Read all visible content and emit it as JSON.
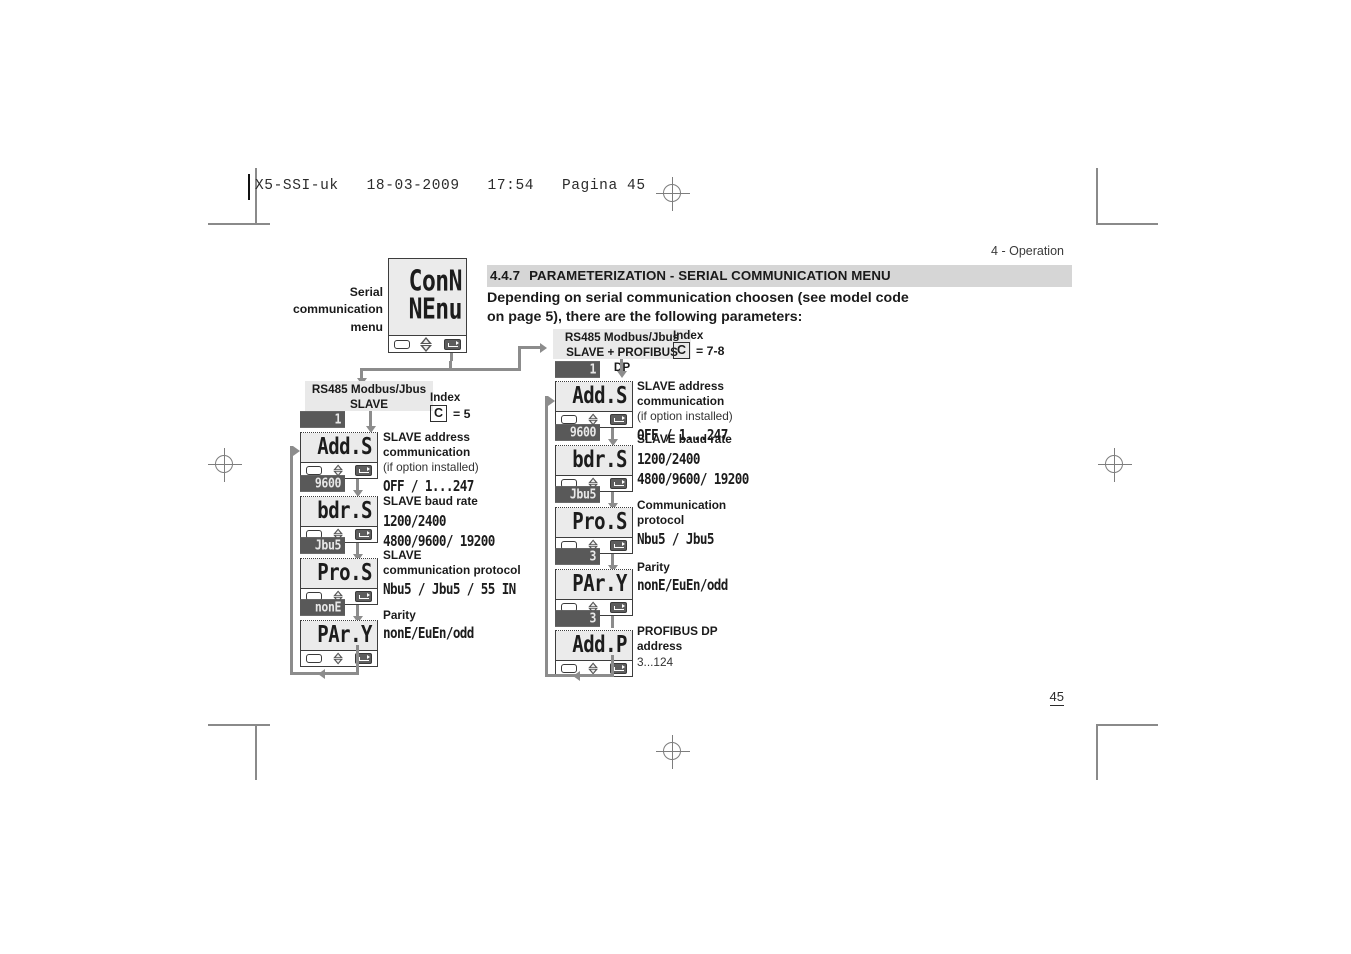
{
  "file_header": "X5-SSI-uk   18-03-2009   17:54   Pagina 45",
  "running_head": "4 - Operation",
  "page_number": "45",
  "section": {
    "number": "4.4.7",
    "title": "PARAMETERIZATION - SERIAL COMMUNICATION MENU",
    "intro_line1": "Depending on serial communication choosen (see model code",
    "intro_line2": "on page 5), there are the following parameters:"
  },
  "menu_display": {
    "caption_line1": "Serial",
    "caption_line2": "communication",
    "caption_line3": "menu",
    "line1": "ConN",
    "line2": "NEnu"
  },
  "columns": [
    {
      "header_line1": "RS485 Modbus/Jbus",
      "header_line2": "SLAVE",
      "index_label": "Index",
      "index_key": "C",
      "index_value": "= 5",
      "items": [
        {
          "badge": "1",
          "display": "Add.S",
          "label_bold_1": "SLAVE address",
          "label_bold_2": "communication",
          "label_note": "(if option installed)",
          "seg_value": "OFF  / 1...247"
        },
        {
          "badge": "9600",
          "display": "bdr.S",
          "label_bold_1": "SLAVE baud rate",
          "seg_value": "1200/2400",
          "seg_value_2": "4800/9600/ 19200"
        },
        {
          "badge": "Jbu5",
          "display": "Pro.S",
          "label_bold_1": "SLAVE",
          "label_bold_2": "communication protocol",
          "seg_value": "Nbu5 / Jbu5 / 55 IN"
        },
        {
          "badge": "nonE",
          "display": "PAr.Y",
          "label_bold_1": "Parity",
          "seg_value": "nonE/EuEn/odd"
        }
      ]
    },
    {
      "header_line1": "RS485 Modbus/Jbus",
      "header_line2": "SLAVE + PROFIBUS DP",
      "index_label": "Index",
      "index_key": "C",
      "index_value": "= 7-8",
      "items": [
        {
          "badge": "1",
          "display": "Add.S",
          "label_bold_1": "SLAVE address",
          "label_bold_2": "communication",
          "label_note": "(if option installed)",
          "seg_value": "OFF  / 1...247"
        },
        {
          "badge": "9600",
          "display": "bdr.S",
          "label_bold_1": "SLAVE baud rate",
          "seg_value": "1200/2400",
          "seg_value_2": "4800/9600/ 19200"
        },
        {
          "badge": "Jbu5",
          "display": "Pro.S",
          "label_bold_1": "Communication",
          "label_bold_2": "protocol",
          "seg_value": "Nbu5 / Jbu5"
        },
        {
          "badge": "3",
          "display": "PAr.Y",
          "label_bold_1": "Parity",
          "seg_value": "nonE/EuEn/odd"
        },
        {
          "badge": "3",
          "display": "Add.P",
          "label_bold_1": "PROFIBUS DP",
          "label_bold_2": "address",
          "label_note": "3...124"
        }
      ]
    }
  ]
}
